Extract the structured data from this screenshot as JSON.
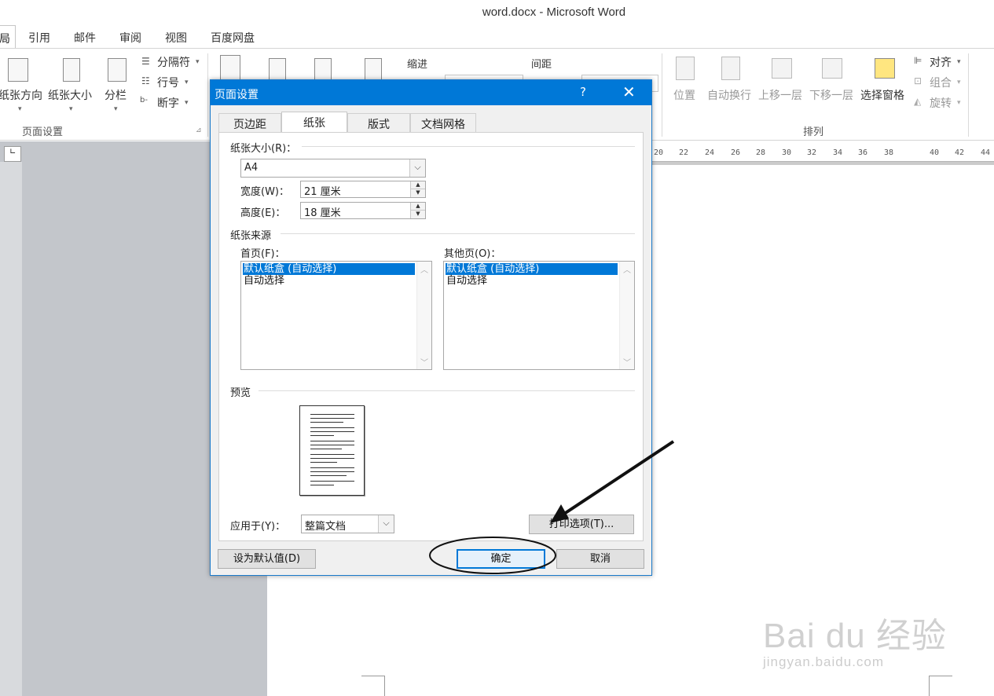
{
  "window": {
    "title": "word.docx - Microsoft Word"
  },
  "ribbon_tabs": [
    {
      "label": "局"
    },
    {
      "label": "引用"
    },
    {
      "label": "邮件"
    },
    {
      "label": "审阅"
    },
    {
      "label": "视图"
    },
    {
      "label": "百度网盘"
    }
  ],
  "ribbon": {
    "page_setup": {
      "orientation": "纸张方向",
      "size": "纸张大小",
      "columns": "分栏",
      "breaks": "分隔符",
      "line_numbers": "行号",
      "hyphenation": "断字",
      "group_label": "页面设置"
    },
    "paragraph": {
      "indent": "缩进",
      "spacing": "间距"
    },
    "arrange": {
      "position": "位置",
      "wrap_text": "自动换行",
      "bring_forward": "上移一层",
      "send_backward": "下移一层",
      "selection_pane": "选择窗格",
      "align": "对齐",
      "group": "组合",
      "rotate": "旋转",
      "group_label": "排列"
    }
  },
  "ruler": {
    "labels": [
      "20",
      "22",
      "24",
      "26",
      "28",
      "30",
      "32",
      "34",
      "36",
      "38",
      "40",
      "42",
      "44"
    ]
  },
  "dialog": {
    "title": "页面设置",
    "help": "?",
    "close": "✕",
    "tabs": [
      {
        "label": "页边距",
        "active": false
      },
      {
        "label": "纸张",
        "active": true
      },
      {
        "label": "版式",
        "active": false
      },
      {
        "label": "文档网格",
        "active": false
      }
    ],
    "paper_size": {
      "label": "纸张大小(R)：",
      "value": "A4",
      "width_label": "宽度(W)：",
      "width_value": "21 厘米",
      "height_label": "高度(E)：",
      "height_value": "18 厘米"
    },
    "paper_source": {
      "label": "纸张来源",
      "first_page_label": "首页(F)：",
      "other_pages_label": "其他页(O)：",
      "first_page_items": [
        {
          "text": "默认纸盒 (自动选择)",
          "selected": true
        },
        {
          "text": "自动选择",
          "selected": false
        }
      ],
      "other_pages_items": [
        {
          "text": "默认纸盒 (自动选择)",
          "selected": true
        },
        {
          "text": "自动选择",
          "selected": false
        }
      ]
    },
    "preview_label": "预览",
    "apply_to": {
      "label": "应用于(Y)：",
      "value": "整篇文档"
    },
    "print_options": "打印选项(T)...",
    "set_default": "设为默认值(D)",
    "ok": "确定",
    "cancel": "取消"
  },
  "watermark": {
    "line1": "Bai du 经验",
    "line2": "jingyan.baidu.com"
  },
  "colors": {
    "accent": "#0078d7",
    "dialog_bg": "#f0f0f0",
    "doc_gray": "#c3c6cb"
  }
}
